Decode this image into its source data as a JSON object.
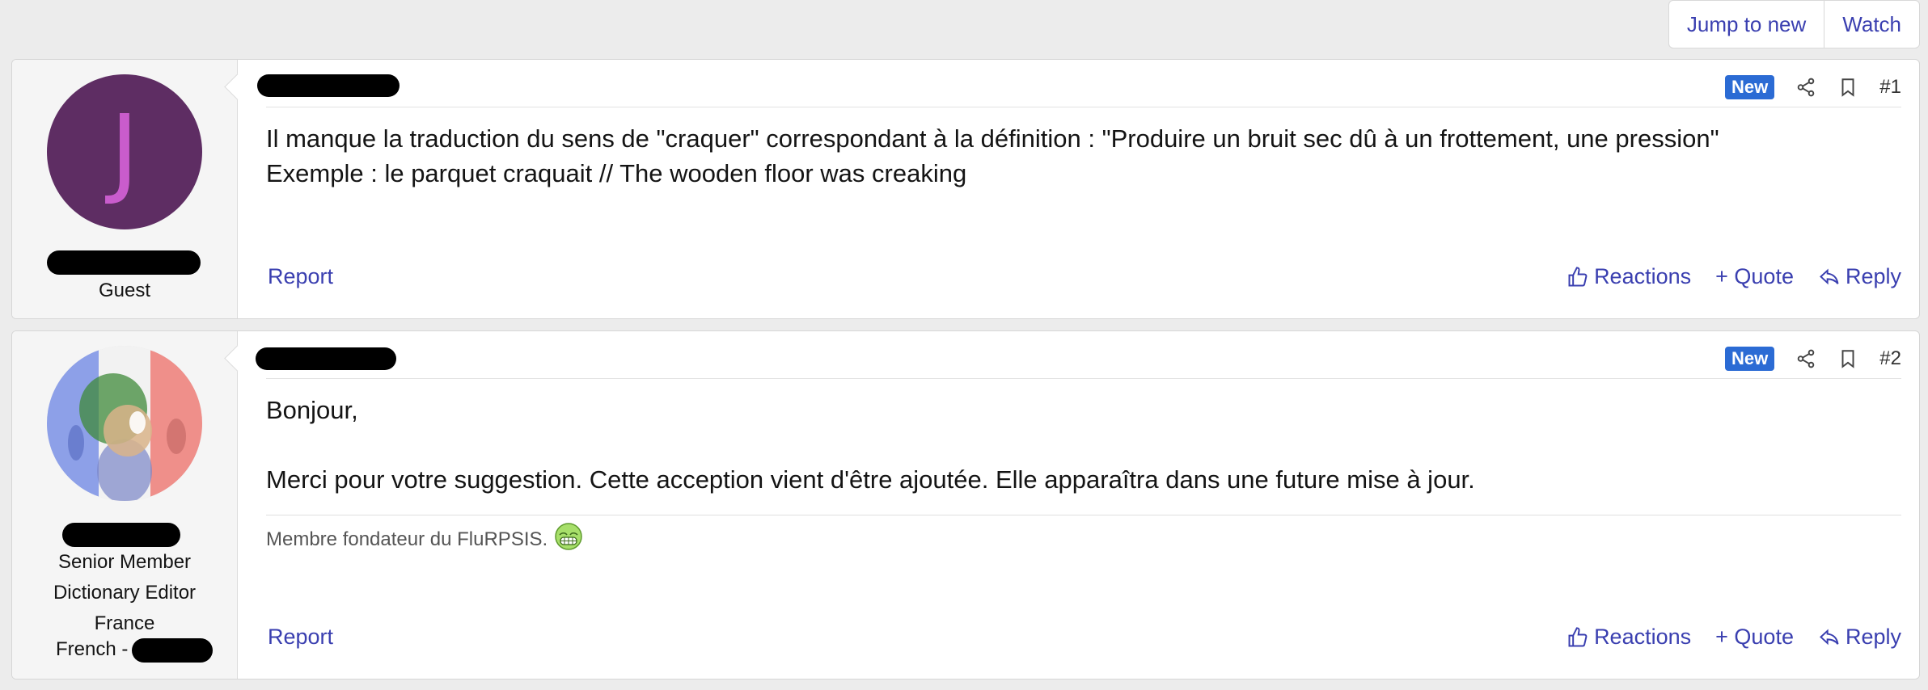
{
  "topbar": {
    "jump_label": "Jump to new",
    "watch_label": "Watch"
  },
  "colors": {
    "link": "#3a3fb0",
    "badge": "#2b6bd4",
    "avatar_bg": "#5e2d63",
    "avatar_letter": "#c95ccc"
  },
  "posts": [
    {
      "avatar_letter": "J",
      "user_titles": [
        "Guest"
      ],
      "badge": "New",
      "number": "#1",
      "body": "Il manque la traduction du sens de \"craquer\" correspondant à la définition : \"Produire un bruit sec dû à un frottement, une pression\"\nExemple : le parquet craquait // The wooden floor was creaking",
      "report_label": "Report",
      "reactions_label": "Reactions",
      "quote_label": "+ Quote",
      "reply_label": "Reply",
      "icons": [
        "share-icon",
        "bookmark-icon",
        "thumbs-up-icon",
        "reply-arrow-icon"
      ]
    },
    {
      "user_titles": [
        "Senior Member",
        "Dictionary Editor",
        "France",
        "French -"
      ],
      "badge": "New",
      "number": "#2",
      "body": "Bonjour,\n\nMerci pour votre suggestion. Cette acception vient d'être ajoutée. Elle apparaîtra dans une future mise à jour.",
      "signature": "Membre fondateur du FluRPSIS.",
      "signature_icon": "grin-emoji-icon",
      "report_label": "Report",
      "reactions_label": "Reactions",
      "quote_label": "+ Quote",
      "reply_label": "Reply"
    }
  ]
}
